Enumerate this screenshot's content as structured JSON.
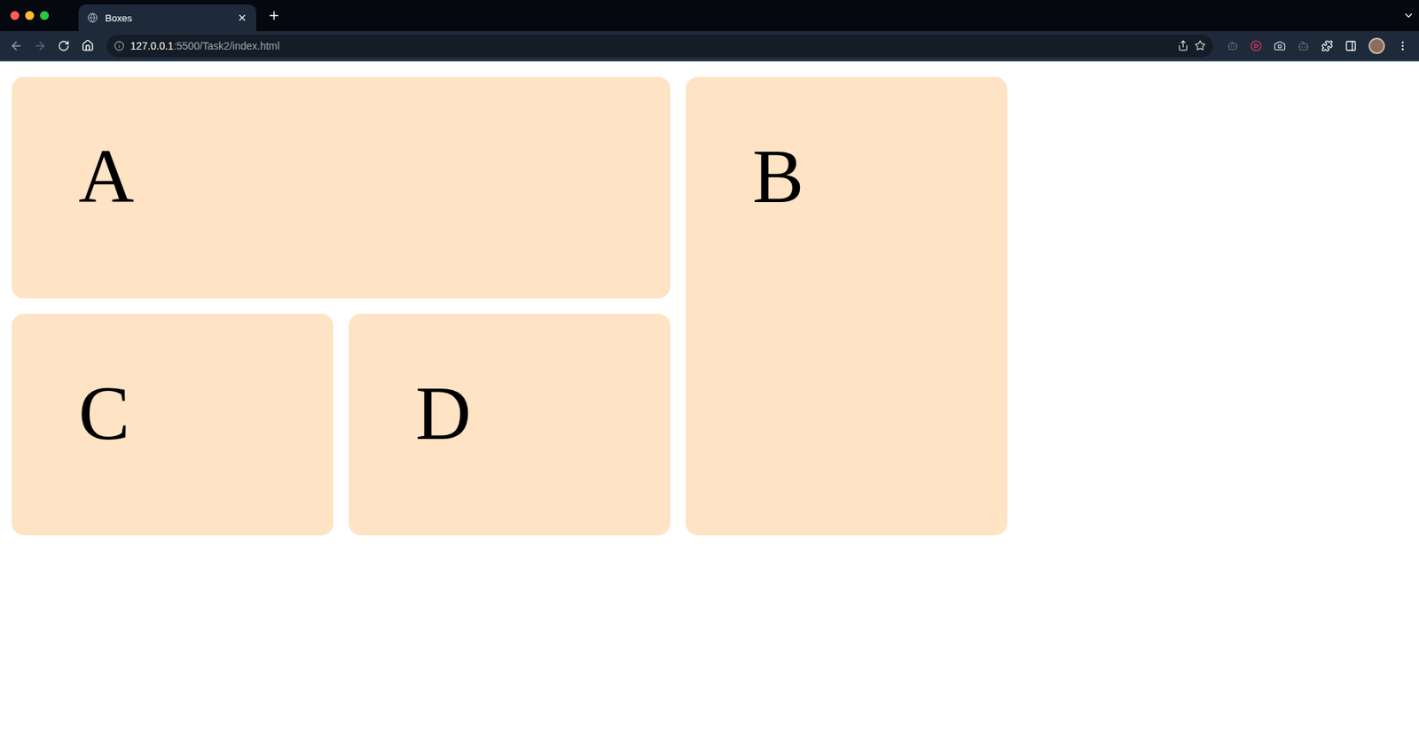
{
  "window": {
    "title": "Boxes"
  },
  "tabs": [
    {
      "label": "Boxes",
      "selected": true
    }
  ],
  "address": {
    "host": "127.0.0.1",
    "rest": ":5500/Task2/index.html"
  },
  "boxes": [
    {
      "label": "A"
    },
    {
      "label": "B"
    },
    {
      "label": "C"
    },
    {
      "label": "D"
    }
  ]
}
